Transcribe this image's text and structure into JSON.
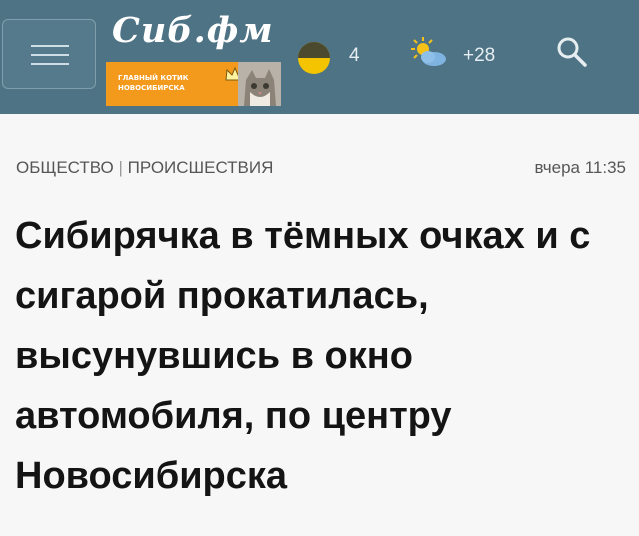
{
  "header": {
    "brand": "Сиб.фм",
    "promo_line1": "ГЛАВНЫЙ КОТИК",
    "promo_line2": "НОВОСИБИРСКА",
    "moon_value": "4",
    "temperature": "+28",
    "icons": [
      "menu-icon",
      "moon-icon",
      "partly-sunny-icon",
      "search-icon",
      "cat-icon",
      "crown-icon"
    ],
    "colors": {
      "bar": "#4e7384",
      "promo": "#f39a1c",
      "moon": "#f5c400"
    }
  },
  "meta": {
    "category": "ОБЩЕСТВО",
    "separator": "|",
    "subcategory": "ПРОИСШЕСТВИЯ",
    "timestamp": "вчера 11:35"
  },
  "article": {
    "title": "Сибирячка в тёмных очках и с сигарой прокатилась, высунувшись в окно автомобиля, по центру Новосибирска"
  }
}
